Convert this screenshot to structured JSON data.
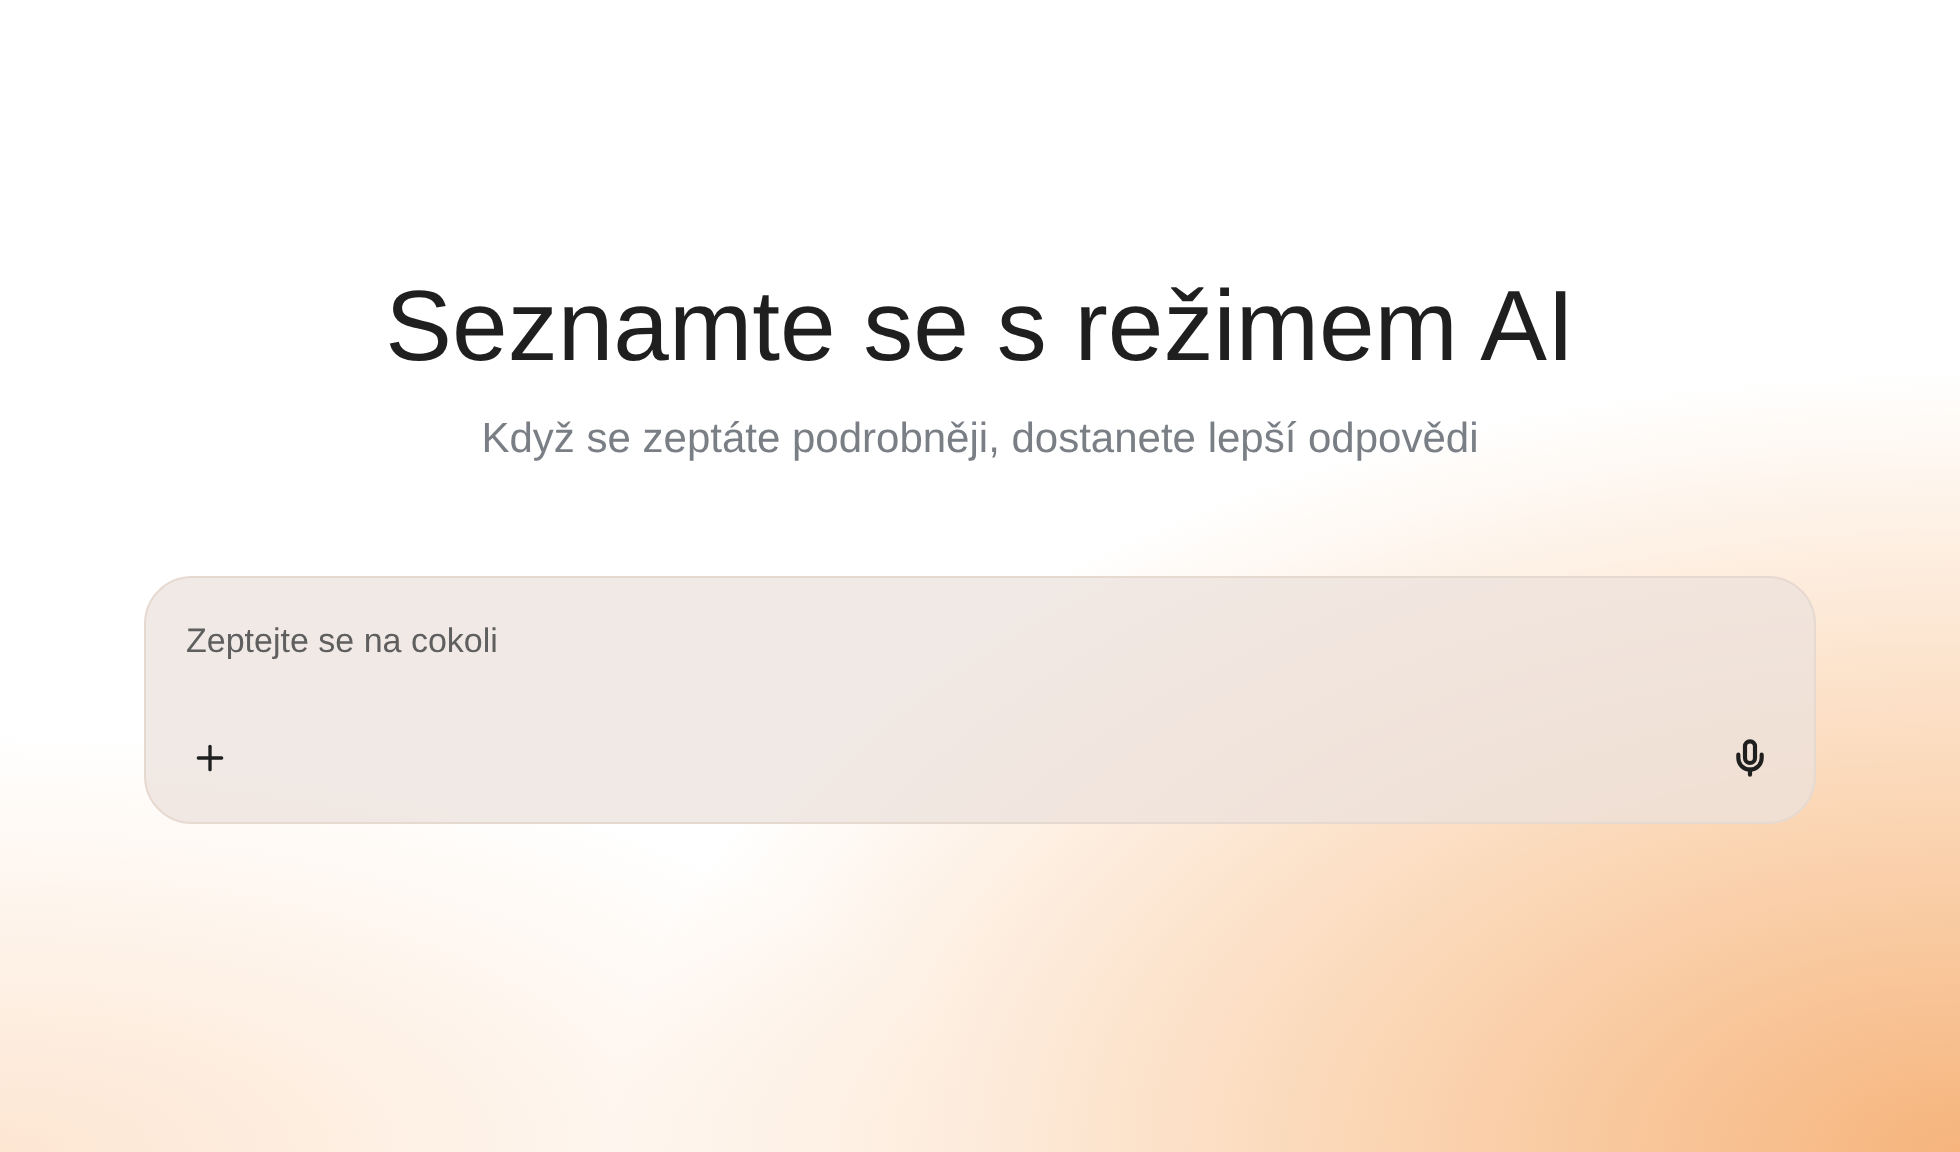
{
  "title": "Seznamte se s režimem AI",
  "subtitle": "Když se zeptáte podrobněji, dostanete lepší odpovědi",
  "search": {
    "placeholder": "Zeptejte se na cokoli"
  }
}
